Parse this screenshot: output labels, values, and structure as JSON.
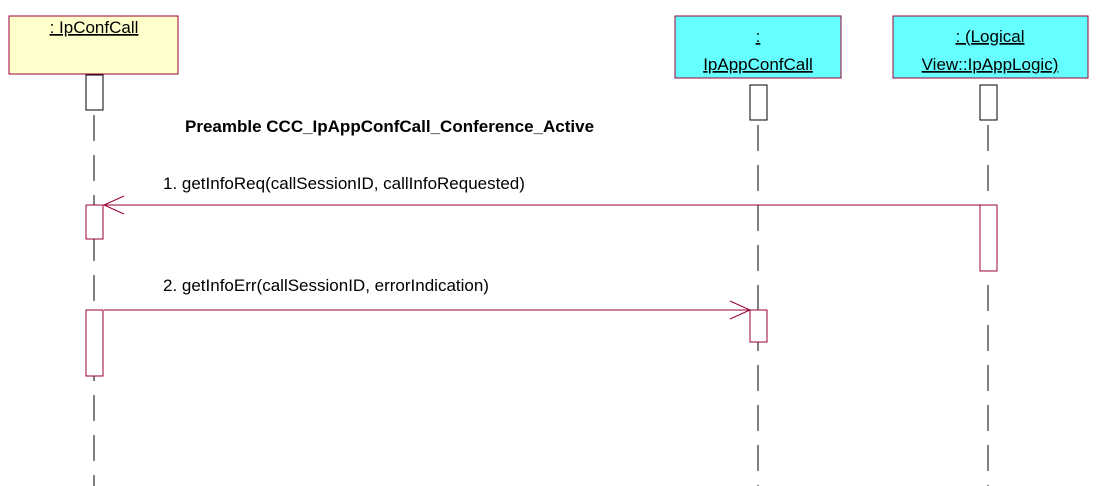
{
  "diagram": {
    "colors": {
      "participant_yellow": "#ffffcc",
      "participant_cyan": "#66ffff",
      "message_line": "#990033",
      "activation_border": "#990033",
      "lifeline": "#000000"
    },
    "participants": [
      {
        "id": "ipconfcall",
        "label_lines": [
          ": IpConfCall"
        ]
      },
      {
        "id": "ipappconfcall",
        "label_lines": [
          ":",
          "IpAppConfCall"
        ]
      },
      {
        "id": "ipapplogic",
        "label_lines": [
          ": (Logical",
          "View::IpAppLogic)"
        ]
      }
    ],
    "preamble": "Preamble CCC_IpAppConfCall_Conference_Active",
    "messages": [
      {
        "label": "1. getInfoReq(callSessionID, callInfoRequested)"
      },
      {
        "label": "2. getInfoErr(callSessionID, errorIndication)"
      }
    ]
  }
}
